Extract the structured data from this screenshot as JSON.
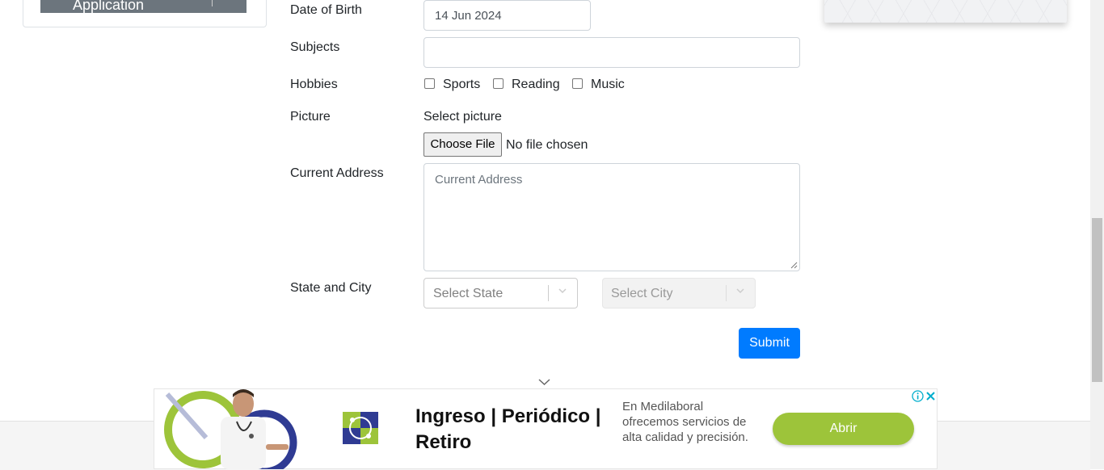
{
  "sidebar": {
    "active_item_label": "Application"
  },
  "form": {
    "dob": {
      "label": "Date of Birth",
      "value": "14 Jun 2024"
    },
    "subjects": {
      "label": "Subjects",
      "value": ""
    },
    "hobbies": {
      "label": "Hobbies",
      "options": [
        {
          "label": "Sports",
          "checked": false
        },
        {
          "label": "Reading",
          "checked": false
        },
        {
          "label": "Music",
          "checked": false
        }
      ]
    },
    "picture": {
      "label": "Picture",
      "prompt": "Select picture",
      "button_label": "Choose File",
      "status": "No file chosen"
    },
    "address": {
      "label": "Current Address",
      "placeholder": "Current Address"
    },
    "state_city": {
      "label": "State and City",
      "state_placeholder": "Select State",
      "city_placeholder": "Select City"
    },
    "submit_label": "Submit"
  },
  "ad": {
    "headline_line1": "Ingreso | Periódico |",
    "headline_line2": "Retiro",
    "body": "En Medilaboral ofrecemos servicios de alta calidad y precisión.",
    "button_label": "Abrir",
    "icons": [
      "info-icon",
      "close-icon"
    ]
  },
  "colors": {
    "primary": "#007bff",
    "ad_button": "#9dc43a",
    "ad_accent": "#2f3b93"
  }
}
